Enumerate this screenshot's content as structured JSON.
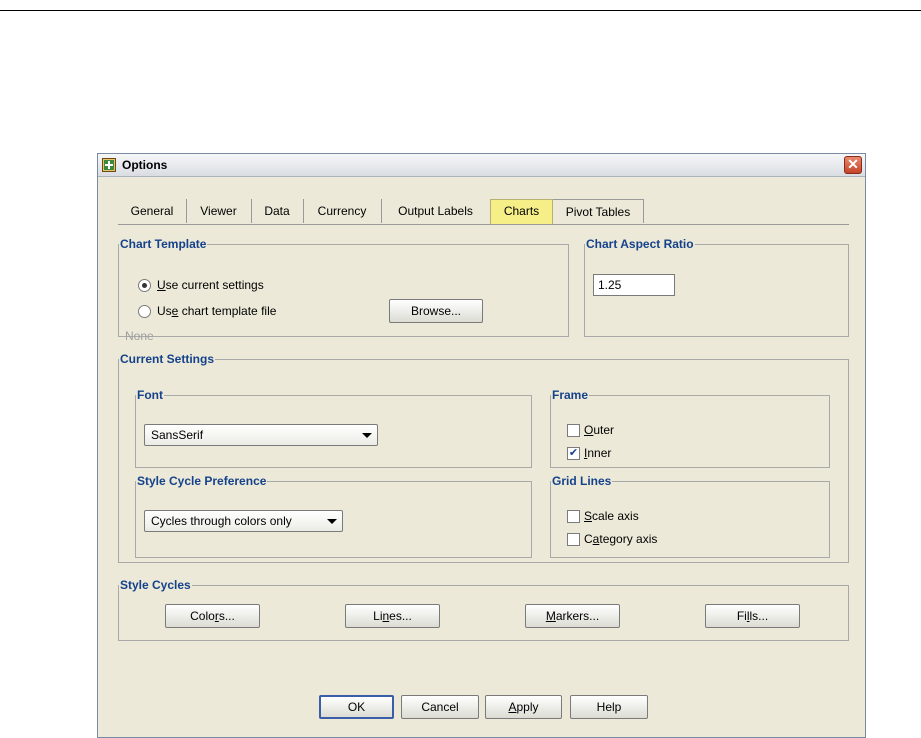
{
  "dialog": {
    "title": "Options",
    "close_symbol": "✕"
  },
  "tabs": [
    {
      "label": "General"
    },
    {
      "label": "Viewer"
    },
    {
      "label": "Data"
    },
    {
      "label": "Currency"
    },
    {
      "label": "Output Labels"
    },
    {
      "label": "Charts",
      "active": true
    },
    {
      "label": "Pivot Tables"
    }
  ],
  "chart_template": {
    "legend": "Chart Template",
    "use_current_pre": "",
    "use_current_mnemonic": "U",
    "use_current_post": "se current settings",
    "use_current_selected": true,
    "use_file_pre": "Us",
    "use_file_mnemonic": "e",
    "use_file_post": " chart template file",
    "browse_label": "Browse...",
    "file_value": "None"
  },
  "aspect_ratio": {
    "legend": "Chart Aspect Ratio",
    "value": "1.25"
  },
  "current_settings": {
    "legend": "Current Settings",
    "font": {
      "legend": "Font",
      "selected": "SansSerif"
    },
    "style_cycle": {
      "legend": "Style Cycle Preference",
      "selected": "Cycles through colors only"
    },
    "frame": {
      "legend": "Frame",
      "outer": {
        "mnemonic": "O",
        "rest": "uter",
        "checked": false
      },
      "inner": {
        "mnemonic": "I",
        "rest": "nner",
        "checked": true
      }
    },
    "grid_lines": {
      "legend": "Grid Lines",
      "scale": {
        "mnemonic": "S",
        "rest": "cale axis",
        "checked": false
      },
      "category": {
        "pre": "C",
        "mnemonic": "a",
        "rest": "tegory axis",
        "checked": false
      }
    }
  },
  "style_cycles": {
    "legend": "Style Cycles",
    "colors": {
      "pre": "Colo",
      "mnemonic": "r",
      "post": "s..."
    },
    "lines": {
      "pre": "Li",
      "mnemonic": "n",
      "post": "es..."
    },
    "markers": {
      "pre": "",
      "mnemonic": "M",
      "post": "arkers..."
    },
    "fills": {
      "pre": "Fi",
      "mnemonic": "l",
      "post": "ls..."
    }
  },
  "footer": {
    "ok": "OK",
    "cancel": "Cancel",
    "apply_mnemonic": "A",
    "apply_rest": "pply",
    "help": "Help"
  },
  "check_symbol": "✔"
}
